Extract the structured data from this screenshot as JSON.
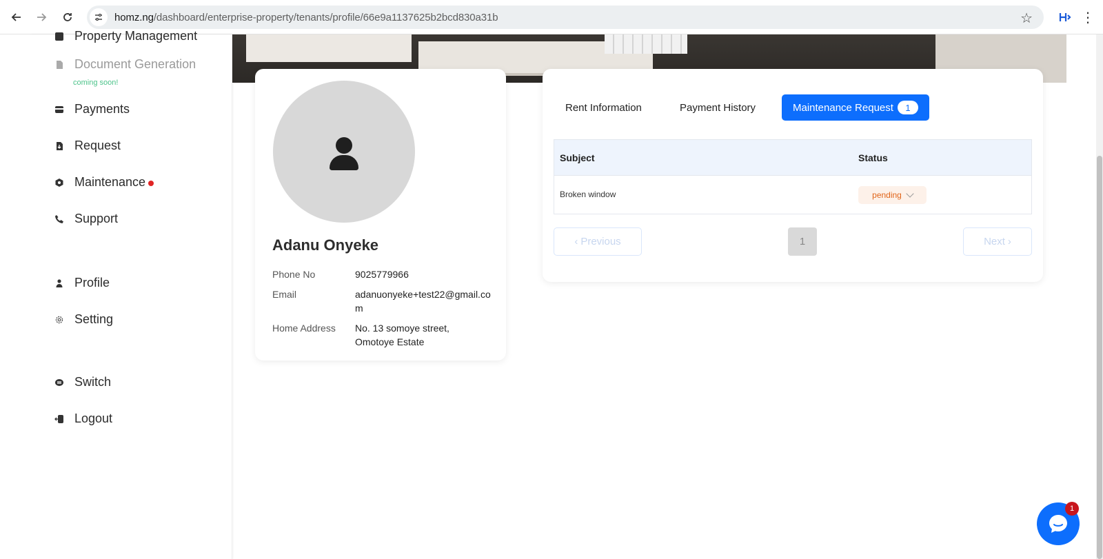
{
  "browser": {
    "url_host": "homz.ng",
    "url_path": "/dashboard/enterprise-property/tenants/profile/66e9a1137625b2bcd830a31b"
  },
  "sidebar": {
    "items": [
      {
        "label": "Property Management",
        "icon": "building-icon"
      },
      {
        "label": "Document Generation",
        "icon": "document-icon",
        "note": "coming soon!"
      },
      {
        "label": "Payments",
        "icon": "wallet-icon"
      },
      {
        "label": "Request",
        "icon": "request-icon"
      },
      {
        "label": "Maintenance",
        "icon": "maintenance-icon"
      },
      {
        "label": "Support",
        "icon": "phone-icon"
      },
      {
        "label": "Profile",
        "icon": "user-icon"
      },
      {
        "label": "Setting",
        "icon": "gear-icon"
      },
      {
        "label": "Switch",
        "icon": "switch-icon"
      },
      {
        "label": "Logout",
        "icon": "logout-icon"
      }
    ]
  },
  "profile": {
    "name": "Adanu Onyeke",
    "phone_label": "Phone No",
    "phone": "9025779966",
    "email_label": "Email",
    "email": "adanuonyeke+test22@gmail.com",
    "address_label": "Home Address",
    "address": "No. 13 somoye street, Omotoye Estate"
  },
  "tabs": {
    "rent": "Rent Information",
    "history": "Payment History",
    "maintenance": "Maintenance Request",
    "maintenance_count": "1"
  },
  "table": {
    "headers": {
      "subject": "Subject",
      "status": "Status"
    },
    "rows": [
      {
        "subject": "Broken window",
        "status": "pending"
      }
    ]
  },
  "pagination": {
    "previous": "Previous",
    "page": "1",
    "next": "Next"
  },
  "chat": {
    "badge": "1"
  },
  "colors": {
    "accent": "#0d6efd",
    "pending_text": "#e0651a",
    "pending_bg": "#fdf1e9",
    "notification_dot": "#e02424"
  }
}
